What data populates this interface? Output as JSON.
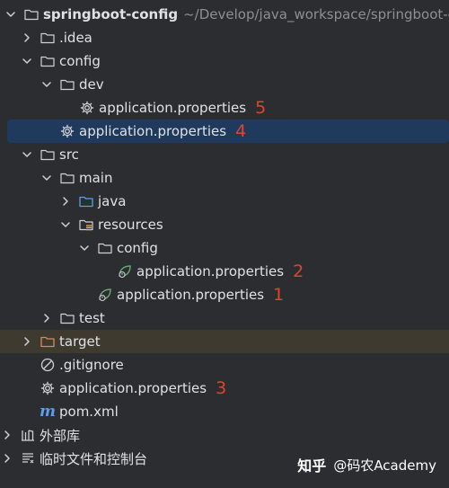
{
  "project": {
    "name": "springboot-config",
    "path": "~/Develop/java_workspace/springboot-cor"
  },
  "items": {
    "idea": ".idea",
    "config": "config",
    "dev": "dev",
    "dev_props": "application.properties",
    "dev_props_num": "5",
    "config_props": "application.properties",
    "config_props_num": "4",
    "src": "src",
    "main": "main",
    "java": "java",
    "resources": "resources",
    "res_config": "config",
    "res_config_props": "application.properties",
    "res_config_props_num": "2",
    "res_props": "application.properties",
    "res_props_num": "1",
    "test": "test",
    "target": "target",
    "gitignore": ".gitignore",
    "root_props": "application.properties",
    "root_props_num": "3",
    "pom": "pom.xml",
    "external_libs": "外部库",
    "scratches": "临时文件和控制台"
  },
  "watermark": {
    "brand": "知乎",
    "author": "@码农Academy"
  },
  "colors": {
    "background": "#2b2d30",
    "selection": "#1f3a5c",
    "excluded": "#3e3a30",
    "annotation": "#e0442f",
    "spring_green": "#6aab73"
  },
  "icons": {
    "folder": "folder-icon",
    "gear": "gear-icon",
    "spring_leaf": "spring-leaf-icon",
    "maven": "maven-m-icon",
    "ignore": "gitignore-icon",
    "library": "library-icon",
    "scratch": "scratch-icon"
  }
}
